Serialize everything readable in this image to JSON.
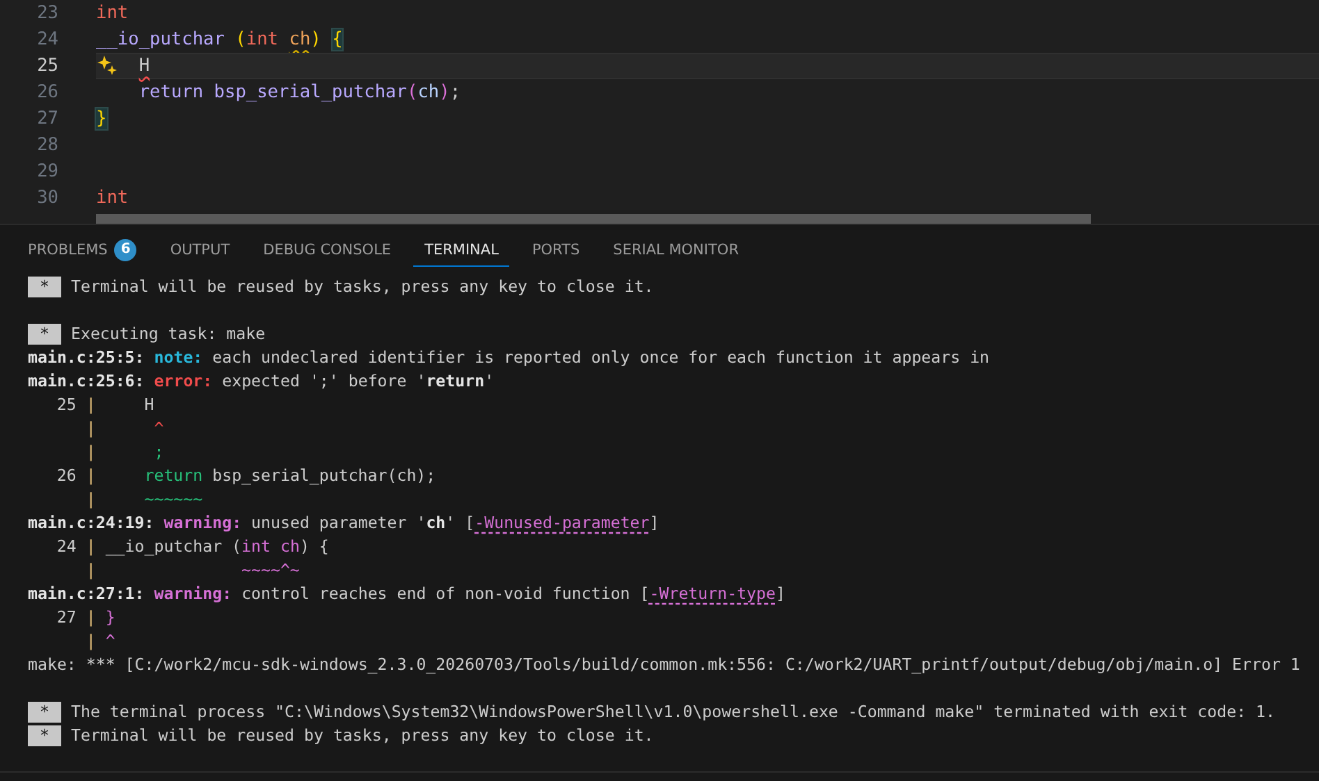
{
  "editor": {
    "lines": [
      {
        "number": "23",
        "current": false,
        "tokens": [
          {
            "text": "int",
            "kind": "keyword"
          }
        ]
      },
      {
        "number": "24",
        "current": false,
        "tokens": [
          {
            "text": "__io_putchar",
            "kind": "function"
          },
          {
            "text": " (",
            "kind": "paren"
          },
          {
            "text": "int",
            "kind": "keyword"
          },
          {
            "text": " ch",
            "kind": "param-warning"
          },
          {
            "text": ")",
            "kind": "paren"
          },
          {
            "text": " {",
            "kind": "bracket-match"
          }
        ]
      },
      {
        "number": "25",
        "current": true,
        "tokens": [
          {
            "text": "    H",
            "kind": "ident-error"
          }
        ]
      },
      {
        "number": "26",
        "current": false,
        "tokens": [
          {
            "text": "    return",
            "kind": "control"
          },
          {
            "text": " bsp_serial_putchar",
            "kind": "function"
          },
          {
            "text": "(",
            "kind": "paren2"
          },
          {
            "text": "ch",
            "kind": "variable"
          },
          {
            "text": ")",
            "kind": "paren2"
          },
          {
            "text": ";",
            "kind": "plain"
          }
        ]
      },
      {
        "number": "27",
        "current": false,
        "tokens": [
          {
            "text": "}",
            "kind": "bracket-match"
          }
        ]
      },
      {
        "number": "28",
        "current": false
      },
      {
        "number": "29",
        "current": false
      },
      {
        "number": "30",
        "current": false,
        "tokens": [
          {
            "text": "int",
            "kind": "keyword"
          }
        ]
      }
    ]
  },
  "panel": {
    "tabs": [
      {
        "label": "PROBLEMS",
        "badge": "6",
        "selected": false
      },
      {
        "label": "OUTPUT",
        "selected": false
      },
      {
        "label": "DEBUG CONSOLE",
        "selected": false
      },
      {
        "label": "TERMINAL",
        "selected": true
      },
      {
        "label": "PORTS",
        "selected": false
      },
      {
        "label": "SERIAL MONITOR",
        "selected": false
      }
    ]
  },
  "terminal": {
    "lines": [
      {
        "kind": "task",
        "marker": "*",
        "text": " Terminal will be reused by tasks, press any key to close it.",
        "spaced": false
      },
      {
        "kind": "task",
        "marker": "*",
        "text": " Executing task: make",
        "spaced": true
      },
      {
        "kind": "message",
        "spaced": false,
        "segments": [
          {
            "text": "main.c:25:5: ",
            "kind": "bold"
          },
          {
            "text": "note:",
            "kind": "note"
          },
          {
            "text": " each undeclared identifier is reported only once for each function it appears in",
            "kind": "plain"
          }
        ]
      },
      {
        "kind": "message",
        "spaced": false,
        "segments": [
          {
            "text": "main.c:25:6: ",
            "kind": "bold"
          },
          {
            "text": "error:",
            "kind": "error"
          },
          {
            "text": " expected ';' before '",
            "kind": "plain"
          },
          {
            "text": "return",
            "kind": "bold"
          },
          {
            "text": "'",
            "kind": "plain"
          }
        ]
      },
      {
        "kind": "source",
        "number": "25",
        "gutter": "|",
        "spaced": false,
        "segments": [
          {
            "text": "    H",
            "kind": "plain"
          }
        ]
      },
      {
        "kind": "source",
        "gutter": "|",
        "spaced": false,
        "segments": [
          {
            "text": "     ^",
            "kind": "red"
          }
        ]
      },
      {
        "kind": "source",
        "gutter": "|",
        "spaced": false,
        "segments": [
          {
            "text": "     ;",
            "kind": "green"
          }
        ]
      },
      {
        "kind": "source",
        "number": "26",
        "gutter": "|",
        "spaced": false,
        "segments": [
          {
            "text": "    return",
            "kind": "green"
          },
          {
            "text": " bsp_serial_putchar(ch);",
            "kind": "plain"
          }
        ]
      },
      {
        "kind": "source",
        "gutter": "|",
        "spaced": false,
        "segments": [
          {
            "text": "    ~~~~~~",
            "kind": "green"
          }
        ]
      },
      {
        "kind": "message",
        "spaced": false,
        "segments": [
          {
            "text": "main.c:24:19: ",
            "kind": "bold"
          },
          {
            "text": "warning:",
            "kind": "warning"
          },
          {
            "text": " unused parameter '",
            "kind": "plain"
          },
          {
            "text": "ch",
            "kind": "bold"
          },
          {
            "text": "' [",
            "kind": "plain"
          },
          {
            "text": "-Wunused-parameter",
            "kind": "flag"
          },
          {
            "text": "]",
            "kind": "plain"
          }
        ]
      },
      {
        "kind": "source",
        "number": "24",
        "gutter": "|",
        "spaced": false,
        "segments": [
          {
            "text": "__io_putchar (",
            "kind": "plain"
          },
          {
            "text": "int ch",
            "kind": "magenta"
          },
          {
            "text": ") {",
            "kind": "plain"
          }
        ]
      },
      {
        "kind": "source",
        "gutter": "|",
        "spaced": false,
        "segments": [
          {
            "text": "              ~~~~^~",
            "kind": "magenta"
          }
        ]
      },
      {
        "kind": "message",
        "spaced": false,
        "segments": [
          {
            "text": "main.c:27:1: ",
            "kind": "bold"
          },
          {
            "text": "warning:",
            "kind": "warning"
          },
          {
            "text": " control reaches end of non-void function [",
            "kind": "plain"
          },
          {
            "text": "-Wreturn-type",
            "kind": "flag"
          },
          {
            "text": "]",
            "kind": "plain"
          }
        ]
      },
      {
        "kind": "source",
        "number": "27",
        "gutter": "|",
        "spaced": false,
        "segments": [
          {
            "text": "}",
            "kind": "magenta"
          }
        ]
      },
      {
        "kind": "source",
        "gutter": "|",
        "spaced": false,
        "segments": [
          {
            "text": "^",
            "kind": "magenta"
          }
        ]
      },
      {
        "kind": "message",
        "spaced": false,
        "segments": [
          {
            "text": "make: *** [C:/work2/mcu-sdk-windows_2.3.0_20260703/Tools/build/common.mk:556: C:/work2/UART_printf/output/debug/obj/main.o] Error 1",
            "kind": "plain"
          }
        ]
      },
      {
        "kind": "task",
        "marker": "*",
        "text": " The terminal process \"C:\\Windows\\System32\\WindowsPowerShell\\v1.0\\powershell.exe -Command make\" terminated with exit code: 1.",
        "spaced": true
      },
      {
        "kind": "task",
        "marker": "*",
        "text": " Terminal will be reused by tasks, press any key to close it.",
        "spaced": false
      }
    ]
  }
}
